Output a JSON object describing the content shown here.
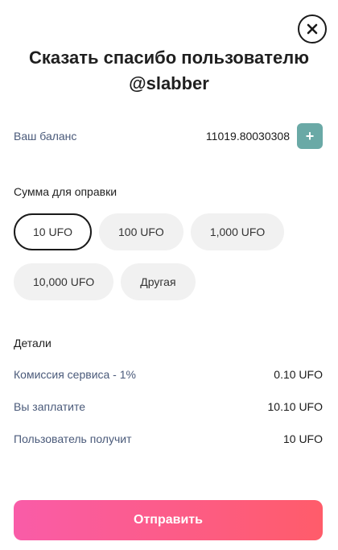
{
  "modal": {
    "title_line1": "Сказать спасибо пользователю",
    "title_line2": "@slabber"
  },
  "balance": {
    "label": "Ваш баланс",
    "value": "11019.80030308",
    "add_label": "+"
  },
  "amount": {
    "label": "Сумма для оправки",
    "options": [
      "10 UFO",
      "100 UFO",
      "1,000 UFO",
      "10,000 UFO",
      "Другая"
    ],
    "selected": "10 UFO"
  },
  "details": {
    "label": "Детали",
    "rows": [
      {
        "label": "Комиссия сервиса - 1%",
        "value": "0.10 UFO"
      },
      {
        "label": "Вы заплатите",
        "value": "10.10 UFO"
      },
      {
        "label": "Пользователь получит",
        "value": "10 UFO"
      }
    ]
  },
  "submit": {
    "label": "Отправить"
  },
  "colors": {
    "accent_start": "#f95ca8",
    "accent_end": "#ff5c6a",
    "plus_button": "#6aa9a6",
    "label_blue": "#4a5a7a"
  },
  "icons": {
    "close": "close-icon"
  }
}
